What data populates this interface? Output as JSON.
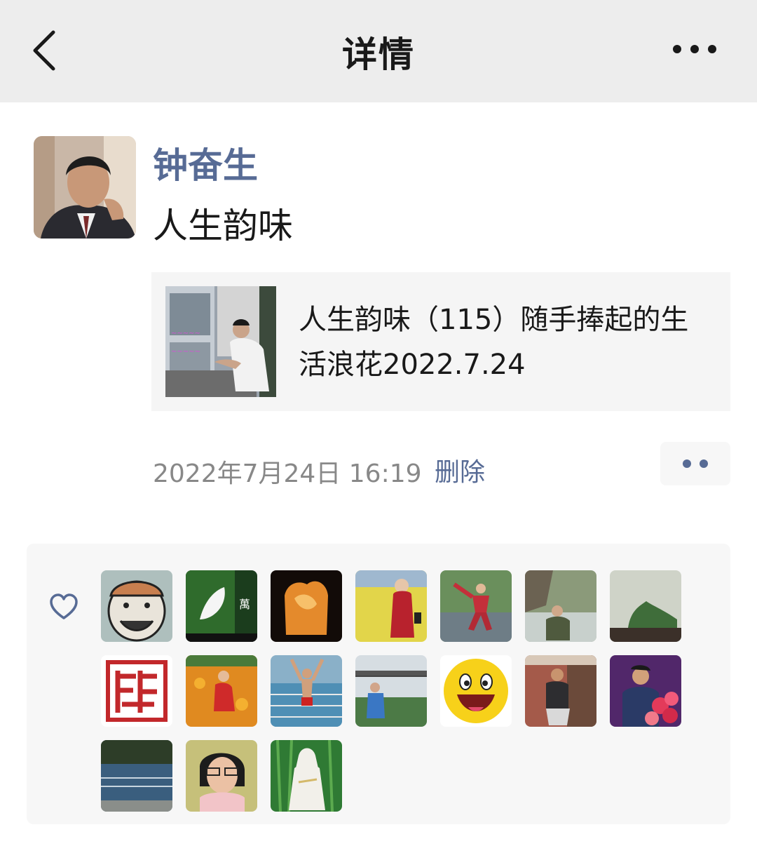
{
  "header": {
    "title": "详情",
    "back_icon": "chevron-left-icon",
    "more_icon": "more-dots-icon"
  },
  "post": {
    "author": "钟奋生",
    "text": "人生韵味",
    "link": {
      "title": "人生韵味（115）随手捧起的生活浪花2022.7.24"
    },
    "timestamp": "2022年7月24日 16:19",
    "delete_label": "删除"
  },
  "likes": {
    "icon": "heart-outline-icon",
    "users": [
      {
        "avatar": "cartoon-face"
      },
      {
        "avatar": "white-flower"
      },
      {
        "avatar": "amber-stone"
      },
      {
        "avatar": "rapeseed-field"
      },
      {
        "avatar": "taichi-park"
      },
      {
        "avatar": "river-hill"
      },
      {
        "avatar": "green-plant"
      },
      {
        "avatar": "red-seal"
      },
      {
        "avatar": "flower-field"
      },
      {
        "avatar": "swimming-pool"
      },
      {
        "avatar": "bridge-river"
      },
      {
        "avatar": "smiley-face"
      },
      {
        "avatar": "pavilion-man"
      },
      {
        "avatar": "stage-flowers"
      },
      {
        "avatar": "lake-dock"
      },
      {
        "avatar": "woman-glasses"
      },
      {
        "avatar": "bamboo-statue"
      }
    ]
  },
  "colors": {
    "link_blue": "#576b95",
    "header_bg": "#ededed",
    "panel_bg": "#f7f7f7"
  }
}
